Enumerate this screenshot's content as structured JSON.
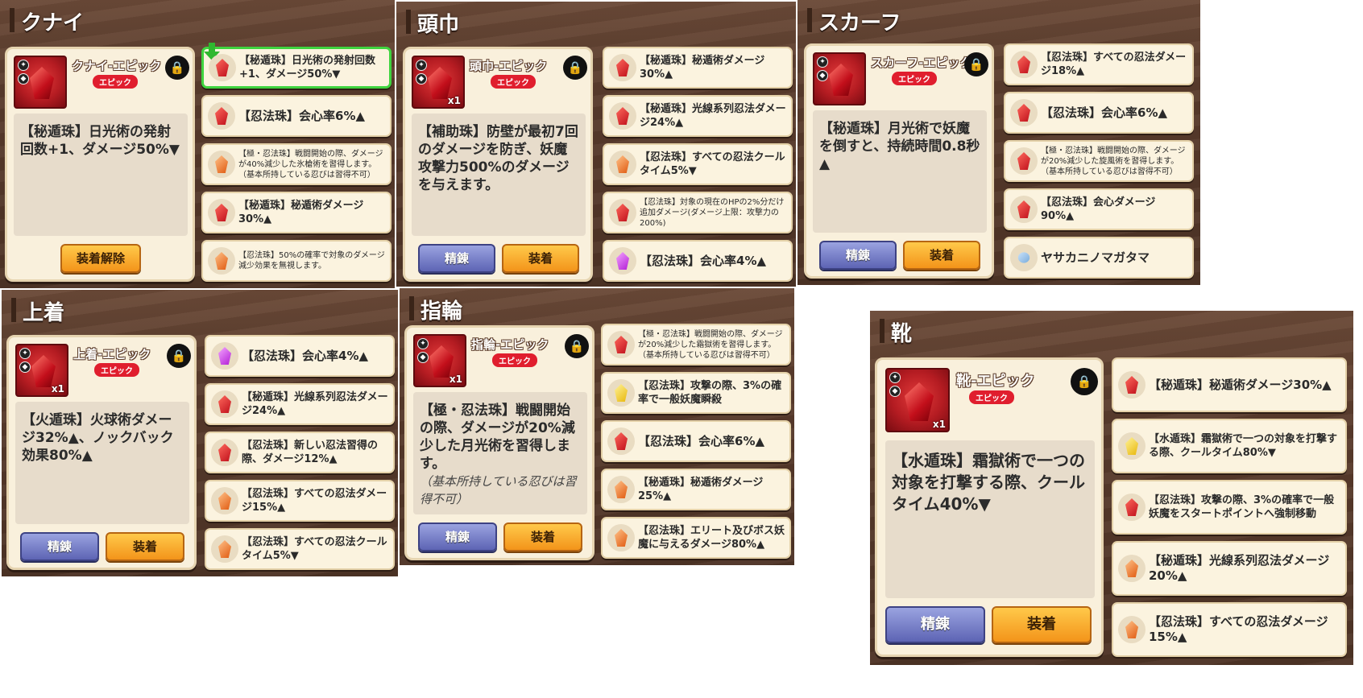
{
  "lock_glyph": "🔒",
  "panels": {
    "kunai": {
      "title": "クナイ",
      "item_name": "クナイ-エピック",
      "rarity": "エピック",
      "description": "【秘遁珠】日光術の発射回数+1、ダメージ50%▼",
      "buttons": {
        "unequip": "装着解除"
      },
      "options": [
        "【秘遁珠】日光術の発射回数+1、ダメージ50%▼",
        "【忍法珠】会心率6%▲",
        "【極・忍法珠】戦闘開始の際、ダメージが40%減少した氷槍術を習得します。（基本所持している忍びは習得不可）",
        "【秘遁珠】秘遁術ダメージ30%▲",
        "【忍法珠】50%の確率で対象のダメージ減少効果を無視します。"
      ]
    },
    "zukin": {
      "title": "頭巾",
      "item_name": "頭巾-エピック",
      "rarity": "エピック",
      "count": "x1",
      "description": "【補助珠】防壁が最初7回のダメージを防ぎ、妖魔攻撃力500%のダメージを与えます。",
      "buttons": {
        "refine": "精錬",
        "equip": "装着"
      },
      "options": [
        "【秘遁珠】秘遁術ダメージ30%▲",
        "【秘遁珠】光線系列忍法ダメージ24%▲",
        "【忍法珠】すべての忍法クールタイム5%▼",
        "【忍法珠】対象の現在のHPの2%分だけ追加ダメージ(ダメージ上限：攻撃力の200%)",
        "【忍法珠】会心率4%▲"
      ]
    },
    "scarf": {
      "title": "スカーフ",
      "item_name": "スカーフ-エピック",
      "rarity": "エピック",
      "description": "【秘遁珠】月光術で妖魔を倒すと、持続時間0.8秒▲",
      "buttons": {
        "refine": "精錬",
        "equip": "装着"
      },
      "options": [
        "【忍法珠】すべての忍法ダメージ18%▲",
        "【忍法珠】会心率6%▲",
        "【極・忍法珠】戦闘開始の際、ダメージが20%減少した旋風術を習得します。（基本所持している忍びは習得不可）",
        "【忍法珠】会心ダメージ90%▲",
        "ヤサカニノマガタマ"
      ]
    },
    "uwagi": {
      "title": "上着",
      "item_name": "上着-エピック",
      "rarity": "エピック",
      "count": "x1",
      "description": "【火遁珠】火球術ダメージ32%▲、ノックバック効果80%▲",
      "buttons": {
        "refine": "精錬",
        "equip": "装着"
      },
      "options": [
        "【忍法珠】会心率4%▲",
        "【秘遁珠】光線系列忍法ダメージ24%▲",
        "【忍法珠】新しい忍法習得の際、ダメージ12%▲",
        "【忍法珠】すべての忍法ダメージ15%▲",
        "【忍法珠】すべての忍法クールタイム5%▼"
      ]
    },
    "yubiwa": {
      "title": "指輪",
      "item_name": "指輪-エピック",
      "rarity": "エピック",
      "count": "x1",
      "description": "【極・忍法珠】戦闘開始の際、ダメージが20%減少した月光術を習得します。",
      "description_note": "（基本所持している忍びは習得不可）",
      "buttons": {
        "refine": "精錬",
        "equip": "装着"
      },
      "options": [
        "【極・忍法珠】戦闘開始の際、ダメージが20%減少した霜獄術を習得します。（基本所持している忍びは習得不可）",
        "【忍法珠】攻撃の際、3%の確率で一般妖魔瞬殺",
        "【忍法珠】会心率6%▲",
        "【秘遁珠】秘遁術ダメージ25%▲",
        "【忍法珠】エリート及びボス妖魔に与えるダメージ80%▲"
      ]
    },
    "kutsu": {
      "title": "靴",
      "item_name": "靴-エピック",
      "rarity": "エピック",
      "count": "x1",
      "description": "【水遁珠】霜獄術で一つの対象を打撃する際、クールタイム40%▼",
      "buttons": {
        "refine": "精錬",
        "equip": "装着"
      },
      "options": [
        "【秘遁珠】秘遁術ダメージ30%▲",
        "【水遁珠】霜獄術で一つの対象を打撃する際、クールタイム80%▼",
        "【忍法珠】攻撃の際、3%の確率で一般妖魔をスタートポイントへ強制移動",
        "【秘遁珠】光線系列忍法ダメージ20%▲",
        "【忍法珠】すべての忍法ダメージ15%▲"
      ]
    }
  }
}
